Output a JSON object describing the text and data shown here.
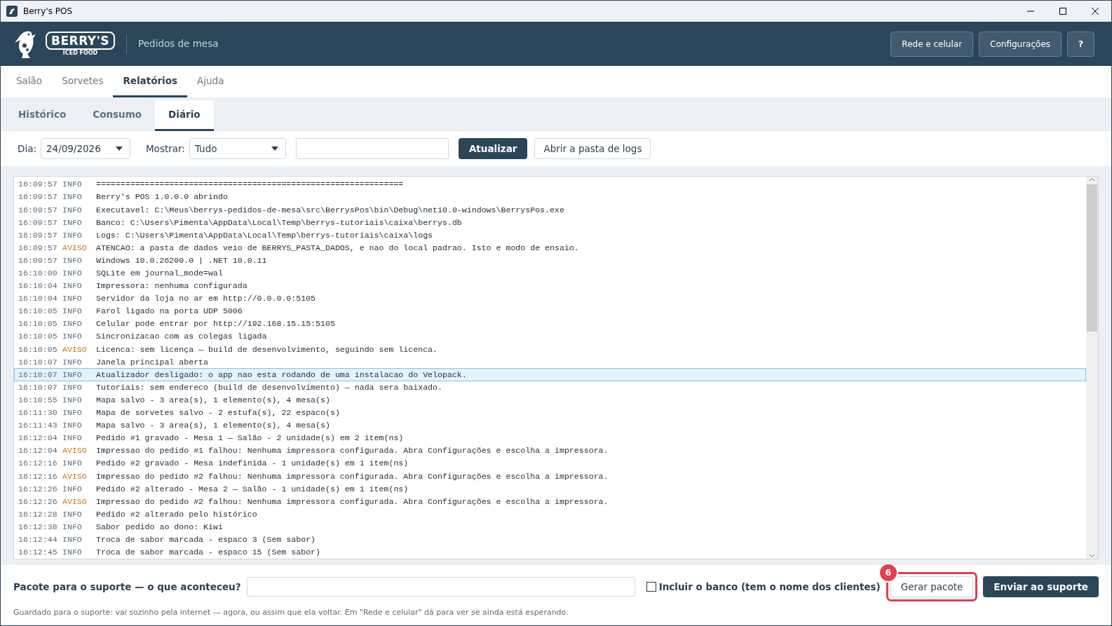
{
  "window": {
    "title": "Berry's POS"
  },
  "header": {
    "logo_text": "BERRY'S",
    "logo_subtext": "ICED FOOD",
    "subtitle": "Pedidos de mesa",
    "buttons": [
      "Rede e celular",
      "Configurações",
      "?"
    ]
  },
  "tabs": [
    {
      "label": "Salão",
      "selected": false
    },
    {
      "label": "Sorvetes",
      "selected": false
    },
    {
      "label": "Relatórios",
      "selected": true
    },
    {
      "label": "Ajuda",
      "selected": false
    }
  ],
  "subtabs": [
    {
      "label": "Histórico",
      "selected": false
    },
    {
      "label": "Consumo",
      "selected": false
    },
    {
      "label": "Diário",
      "selected": true
    }
  ],
  "toolbar": {
    "day_label": "Dia:",
    "day_value": "24/09/2026",
    "show_label": "Mostrar:",
    "show_value": "Tudo",
    "refresh_button": "Atualizar",
    "open_logs_button": "Abrir a pasta de logs"
  },
  "log": [
    {
      "time": "16:09:57",
      "level": "INFO",
      "kind": "info",
      "message": "===============================================================",
      "selected": false
    },
    {
      "time": "16:09:57",
      "level": "INFO",
      "kind": "info",
      "message": "Berry's POS 1.0.0.0 abrindo",
      "selected": false
    },
    {
      "time": "16:09:57",
      "level": "INFO",
      "kind": "info",
      "message": "Executavel: C:\\Meus\\berrys-pedidos-de-mesa\\src\\BerrysPos\\bin\\Debug\\net10.0-windows\\BerrysPos.exe",
      "selected": false
    },
    {
      "time": "16:09:57",
      "level": "INFO",
      "kind": "info",
      "message": "Banco: C:\\Users\\Pimenta\\AppData\\Local\\Temp\\berrys-tutoriais\\caixa\\berrys.db",
      "selected": false
    },
    {
      "time": "16:09:57",
      "level": "INFO",
      "kind": "info",
      "message": "Logs: C:\\Users\\Pimenta\\AppData\\Local\\Temp\\berrys-tutoriais\\caixa\\logs",
      "selected": false
    },
    {
      "time": "16:09:57",
      "level": "AVISO",
      "kind": "warning",
      "message": "ATENCAO: a pasta de dados veio de BERRYS_PASTA_DADOS, e nao do local padrao. Isto e modo de ensaio.",
      "selected": false
    },
    {
      "time": "16:09:57",
      "level": "INFO",
      "kind": "info",
      "message": "Windows 10.0.26200.0 | .NET 10.0.11",
      "selected": false
    },
    {
      "time": "16:10:00",
      "level": "INFO",
      "kind": "info",
      "message": "SQLite em journal_mode=wal",
      "selected": false
    },
    {
      "time": "16:10:04",
      "level": "INFO",
      "kind": "info",
      "message": "Impressora: nenhuma configurada",
      "selected": false
    },
    {
      "time": "16:10:04",
      "level": "INFO",
      "kind": "info",
      "message": "Servidor da loja no ar em http://0.0.0.0:5105",
      "selected": false
    },
    {
      "time": "16:10:05",
      "level": "INFO",
      "kind": "info",
      "message": "Farol ligado na porta UDP 5006",
      "selected": false
    },
    {
      "time": "16:10:05",
      "level": "INFO",
      "kind": "info",
      "message": "Celular pode entrar por http://192.168.15.15:5105",
      "selected": false
    },
    {
      "time": "16:10:05",
      "level": "INFO",
      "kind": "info",
      "message": "Sincronizacao com as colegas ligada",
      "selected": false
    },
    {
      "time": "16:10:05",
      "level": "AVISO",
      "kind": "warning",
      "message": "Licenca: sem licença — build de desenvolvimento, seguindo sem licenca.",
      "selected": false
    },
    {
      "time": "16:10:07",
      "level": "INFO",
      "kind": "info",
      "message": "Janela principal aberta",
      "selected": false
    },
    {
      "time": "16:10:07",
      "level": "INFO",
      "kind": "info",
      "message": "Atualizador desligado: o app nao esta rodando de uma instalacao do Velopack.",
      "selected": true
    },
    {
      "time": "16:10:07",
      "level": "INFO",
      "kind": "info",
      "message": "Tutoriais: sem endereco (build de desenvolvimento) — nada sera baixado.",
      "selected": false
    },
    {
      "time": "16:10:55",
      "level": "INFO",
      "kind": "info",
      "message": "Mapa salvo - 3 area(s), 1 elemento(s), 4 mesa(s)",
      "selected": false
    },
    {
      "time": "16:11:30",
      "level": "INFO",
      "kind": "info",
      "message": "Mapa de sorvetes salvo - 2 estufa(s), 22 espaco(s)",
      "selected": false
    },
    {
      "time": "16:11:43",
      "level": "INFO",
      "kind": "info",
      "message": "Mapa salvo - 3 area(s), 1 elemento(s), 4 mesa(s)",
      "selected": false
    },
    {
      "time": "16:12:04",
      "level": "INFO",
      "kind": "info",
      "message": "Pedido #1 gravado - Mesa 1 — Salão - 2 unidade(s) em 2 item(ns)",
      "selected": false
    },
    {
      "time": "16:12:04",
      "level": "AVISO",
      "kind": "warning",
      "message": "Impressao do pedido #1 falhou: Nenhuma impressora configurada. Abra Configurações e escolha a impressora.",
      "selected": false
    },
    {
      "time": "16:12:16",
      "level": "INFO",
      "kind": "info",
      "message": "Pedido #2 gravado - Mesa indefinida - 1 unidade(s) em 1 item(ns)",
      "selected": false
    },
    {
      "time": "16:12:16",
      "level": "AVISO",
      "kind": "warning",
      "message": "Impressao do pedido #2 falhou: Nenhuma impressora configurada. Abra Configurações e escolha a impressora.",
      "selected": false
    },
    {
      "time": "16:12:26",
      "level": "INFO",
      "kind": "info",
      "message": "Pedido #2 alterado - Mesa 2 — Salão - 1 unidade(s) em 1 item(ns)",
      "selected": false
    },
    {
      "time": "16:12:26",
      "level": "AVISO",
      "kind": "warning",
      "message": "Impressao do pedido #2 falhou: Nenhuma impressora configurada. Abra Configurações e escolha a impressora.",
      "selected": false
    },
    {
      "time": "16:12:28",
      "level": "INFO",
      "kind": "info",
      "message": "Pedido #2 alterado pelo histórico",
      "selected": false
    },
    {
      "time": "16:12:38",
      "level": "INFO",
      "kind": "info",
      "message": "Sabor pedido ao dono: Kiwi",
      "selected": false
    },
    {
      "time": "16:12:44",
      "level": "INFO",
      "kind": "info",
      "message": "Troca de sabor marcada - espaco 3 (Sem sabor)",
      "selected": false
    },
    {
      "time": "16:12:45",
      "level": "INFO",
      "kind": "info",
      "message": "Troca de sabor marcada - espaco 15 (Sem sabor)",
      "selected": false
    }
  ],
  "support": {
    "label": "Pacote para o suporte — o que aconteceu?",
    "include_db": {
      "label": "Incluir o banco (tem o nome dos clientes)",
      "checked": false
    },
    "tutorial_step": "6",
    "generate_button": "Gerar pacote",
    "send_button": "Enviar ao suporte",
    "note": "Guardado para o suporte: vai sozinho pela internet — agora, ou assim que ela voltar. Em \"Rede e celular\" dá para ver se ainda está esperando."
  }
}
